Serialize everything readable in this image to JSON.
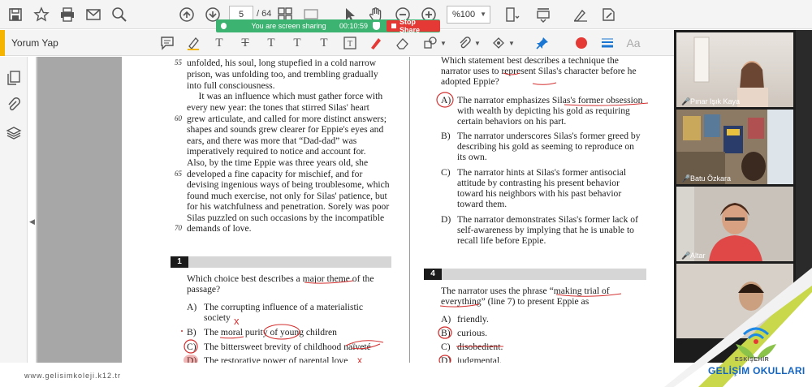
{
  "toolbar": {
    "page_current": "5",
    "page_total": "/ 64",
    "zoom": "%100",
    "icons": [
      "save-icon",
      "bookmark-star-icon",
      "print-icon",
      "mail-icon",
      "search-zoom-icon",
      "page-up-icon",
      "page-down-icon",
      "fit-page-icon",
      "presentation-icon",
      "cursor-icon",
      "hand-icon",
      "zoom-out-icon",
      "zoom-in-icon",
      "rotate-icon",
      "read-mode-icon",
      "sign-icon",
      "fill-sign-icon"
    ]
  },
  "share": {
    "status": "You are screen sharing",
    "time": "00:10:59",
    "stop_label": "Stop Share"
  },
  "comment_toolbar": {
    "label": "Yorum Yap",
    "aa_label": "Aa",
    "colors": {
      "accent": "#f4b400",
      "red": "#e53935",
      "blue": "#1976d2"
    }
  },
  "passage": {
    "lines": [
      {
        "num": "55",
        "text": "unfolded, his soul, long stupefied in a cold narrow"
      },
      {
        "num": "",
        "text": "prison, was unfolding too, and trembling gradually"
      },
      {
        "num": "",
        "text": "into full consciousness."
      },
      {
        "num": "",
        "text": "     It was an influence which must gather force with"
      },
      {
        "num": "",
        "text": "every new year: the tones that stirred Silas' heart"
      },
      {
        "num": "60",
        "text": "grew articulate, and called for more distinct answers;"
      },
      {
        "num": "",
        "text": "shapes and sounds grew clearer for Eppie's eyes and"
      },
      {
        "num": "",
        "text": "ears, and there was more that “Dad-dad” was"
      },
      {
        "num": "",
        "text": "imperatively required to notice and account for."
      },
      {
        "num": "",
        "text": "Also, by the time Eppie was three years old, she"
      },
      {
        "num": "65",
        "text": "developed a fine capacity for mischief, and for"
      },
      {
        "num": "",
        "text": "devising ingenious ways of being troublesome, which"
      },
      {
        "num": "",
        "text": "found much exercise, not only for Silas' patience, but"
      },
      {
        "num": "",
        "text": "for his watchfulness and penetration. Sorely was poor"
      },
      {
        "num": "",
        "text": "Silas puzzled on such occasions by the incompatible"
      },
      {
        "num": "70",
        "text": "demands of love."
      }
    ]
  },
  "q1": {
    "number": "1",
    "stem": [
      "Which choice best describes a major theme of the",
      "passage?"
    ],
    "options": [
      {
        "letter": "A)",
        "lines": [
          "The corrupting influence of a materialistic",
          "society"
        ]
      },
      {
        "letter": "B)",
        "lines": [
          "The moral purity of young children"
        ]
      },
      {
        "letter": "C)",
        "lines": [
          "The bittersweet brevity of childhood naïveté"
        ]
      },
      {
        "letter": "D)",
        "lines": [
          "The restorative power of parental love"
        ]
      }
    ]
  },
  "q3": {
    "stem": [
      "Which statement best describes a technique the",
      "narrator uses to represent Silas's character before he",
      "adopted Eppie?"
    ],
    "options": [
      {
        "letter": "A)",
        "lines": [
          "The narrator emphasizes Silas's former obsession",
          "with wealth by depicting his gold as requiring",
          "certain behaviors on his part."
        ]
      },
      {
        "letter": "B)",
        "lines": [
          "The narrator underscores Silas's former greed by",
          "describing his gold as seeming to reproduce on",
          "its own."
        ]
      },
      {
        "letter": "C)",
        "lines": [
          "The narrator hints at Silas's former antisocial",
          "attitude by contrasting his present behavior",
          "toward his neighbors with his past behavior",
          "toward them."
        ]
      },
      {
        "letter": "D)",
        "lines": [
          "The narrator demonstrates Silas's former lack of",
          "self-awareness by implying that he is unable to",
          "recall life before Eppie."
        ]
      }
    ]
  },
  "q4": {
    "number": "4",
    "stem": [
      "The narrator uses the phrase “making trial of",
      "everything” (line 7) to present Eppie as"
    ],
    "options": [
      {
        "letter": "A)",
        "lines": [
          "friendly."
        ]
      },
      {
        "letter": "B)",
        "lines": [
          "curious."
        ]
      },
      {
        "letter": "C)",
        "lines": [
          "disobedient."
        ]
      },
      {
        "letter": "D)",
        "lines": [
          "judgmental."
        ]
      }
    ]
  },
  "participants": [
    {
      "name": "Pınar Işık Kaya"
    },
    {
      "name": "Batu Özkara"
    },
    {
      "name": "Altar"
    },
    {
      "name": ""
    }
  ],
  "logo": {
    "line1": "ESKİŞEHİR",
    "line2": "GELİŞİM OKULLARI"
  },
  "footer": {
    "url": "www.gelisimkoleji.k12.tr"
  }
}
